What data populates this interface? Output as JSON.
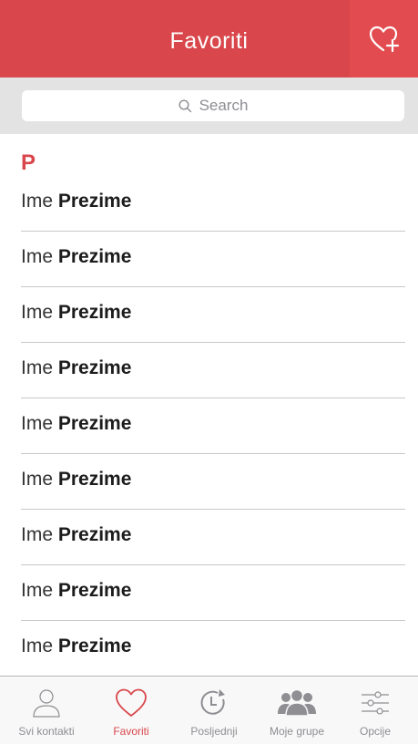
{
  "header": {
    "title": "Favoriti",
    "add_icon": "heart-plus-icon"
  },
  "search": {
    "placeholder": "Search",
    "icon": "search-icon"
  },
  "section": {
    "letter": "P"
  },
  "contacts": [
    {
      "first": "Ime",
      "last": "Prezime"
    },
    {
      "first": "Ime",
      "last": "Prezime"
    },
    {
      "first": "Ime",
      "last": "Prezime"
    },
    {
      "first": "Ime",
      "last": "Prezime"
    },
    {
      "first": "Ime",
      "last": "Prezime"
    },
    {
      "first": "Ime",
      "last": "Prezime"
    },
    {
      "first": "Ime",
      "last": "Prezime"
    },
    {
      "first": "Ime",
      "last": "Prezime"
    },
    {
      "first": "Ime",
      "last": "Prezime"
    }
  ],
  "tabs": [
    {
      "label": "Svi kontakti",
      "icon": "person-icon",
      "active": false
    },
    {
      "label": "Favoriti",
      "icon": "heart-icon",
      "active": true
    },
    {
      "label": "Posljednji",
      "icon": "history-icon",
      "active": false
    },
    {
      "label": "Moje grupe",
      "icon": "group-icon",
      "active": false
    },
    {
      "label": "Opcije",
      "icon": "sliders-icon",
      "active": false
    }
  ],
  "colors": {
    "accent": "#d9464b",
    "inactive": "#8e8e93"
  }
}
